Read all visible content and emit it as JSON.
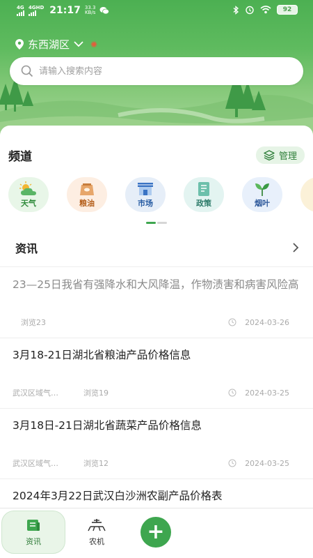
{
  "status_bar": {
    "net1": "4G",
    "net2": "4GHD",
    "time": "21:17",
    "speed_value": "33.3",
    "speed_unit": "KB/s",
    "battery": "92"
  },
  "header": {
    "location": "东西湖区",
    "search_placeholder": "请输入搜索内容"
  },
  "channels": {
    "title": "频道",
    "manage_label": "管理",
    "items": [
      {
        "label": "天气",
        "icon": "weather-icon"
      },
      {
        "label": "粮油",
        "icon": "grain-oil-icon"
      },
      {
        "label": "市场",
        "icon": "market-icon"
      },
      {
        "label": "政策",
        "icon": "policy-icon"
      },
      {
        "label": "烟叶",
        "icon": "tobacco-leaf-icon"
      }
    ]
  },
  "news": {
    "title": "资讯",
    "items": [
      {
        "headline": "23—25日我省有强降水和大风降温，作物渍害和病害风险高",
        "source": "",
        "views": "浏览23",
        "date": "2024-03-26",
        "read": true
      },
      {
        "headline": "3月18-21日湖北省粮油产品价格信息",
        "source": "武汉区域气…",
        "views": "浏览19",
        "date": "2024-03-25",
        "read": false
      },
      {
        "headline": "3月18日-21日湖北省蔬菜产品价格信息",
        "source": "武汉区域气…",
        "views": "浏览12",
        "date": "2024-03-25",
        "read": false
      },
      {
        "headline": "2024年3月22日武汉白沙洲农副产品价格表",
        "source": "",
        "views": "",
        "date": "",
        "read": false
      }
    ]
  },
  "bottom_nav": {
    "news_label": "资讯",
    "machine_label": "农机",
    "add_symbol": "+"
  },
  "colors": {
    "brand_green": "#3ea64f",
    "header_green": "#4cb052"
  }
}
